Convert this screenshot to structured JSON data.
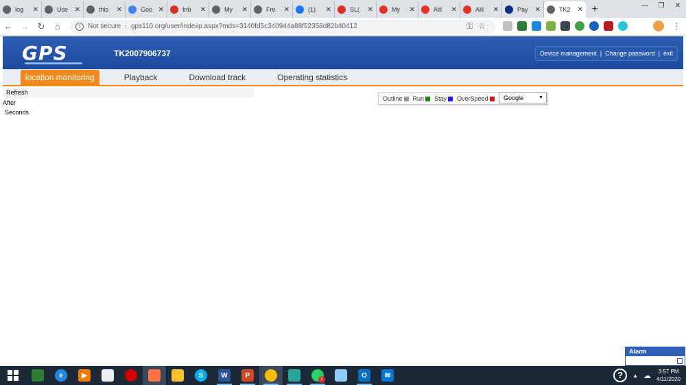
{
  "browser": {
    "tabs": [
      {
        "title": "log",
        "fav": "globe-icon",
        "color": "#5f6368"
      },
      {
        "title": "Use",
        "fav": "globe-icon",
        "color": "#5f6368"
      },
      {
        "title": "this",
        "fav": "globe-icon",
        "color": "#5f6368"
      },
      {
        "title": "Goo",
        "fav": "google-icon",
        "color": "#4285f4"
      },
      {
        "title": "Inb",
        "fav": "gmail-icon",
        "color": "#d93025"
      },
      {
        "title": "My",
        "fav": "globe-icon",
        "color": "#5f6368"
      },
      {
        "title": "Fre",
        "fav": "globe-icon",
        "color": "#5f6368"
      },
      {
        "title": "(1)",
        "fav": "facebook-icon",
        "color": "#1877f2"
      },
      {
        "title": "SL(",
        "fav": "gmail-icon",
        "color": "#d93025"
      },
      {
        "title": "My",
        "fav": "aliexpress-icon",
        "color": "#e43225"
      },
      {
        "title": "Alil",
        "fav": "aliexpress-icon",
        "color": "#e43225"
      },
      {
        "title": "Alil",
        "fav": "aliexpress-icon",
        "color": "#e43225"
      },
      {
        "title": "Pay",
        "fav": "paypal-icon",
        "color": "#003087"
      },
      {
        "title": "TK2",
        "fav": "globe-icon",
        "color": "#5f6368",
        "active": true
      }
    ],
    "security": "Not secure",
    "url": "gps110.org/user/indexp.aspx?mds=3140fd5c340944a88f52358d82b40412"
  },
  "site": {
    "logo": "GPS",
    "device_id": "TK2007906737",
    "links": {
      "device_management": "Device management",
      "change_password": "Change password",
      "exit": "exit",
      "separator": "|"
    },
    "nav": {
      "location_monitoring": "location monitoring",
      "playback": "Playback",
      "download_track": "Download track",
      "operating_statistics": "Operating statistics"
    },
    "panel": {
      "refresh": "Refresh",
      "after": "After",
      "seconds": "Seconds"
    },
    "legend": {
      "outline": "Outline",
      "run": "Run",
      "stay": "Stay",
      "overspeed": "OverSpeed",
      "colors": {
        "outline": "#999999",
        "run": "#1a8a1a",
        "stay": "#1a1aff",
        "overspeed": "#e01010"
      }
    },
    "map_type": "Google",
    "alarm": "Alarm"
  },
  "taskbar": {
    "whatsapp_badge": "1",
    "help": "?",
    "time": "3:57 PM",
    "date": "4/11/2020"
  }
}
